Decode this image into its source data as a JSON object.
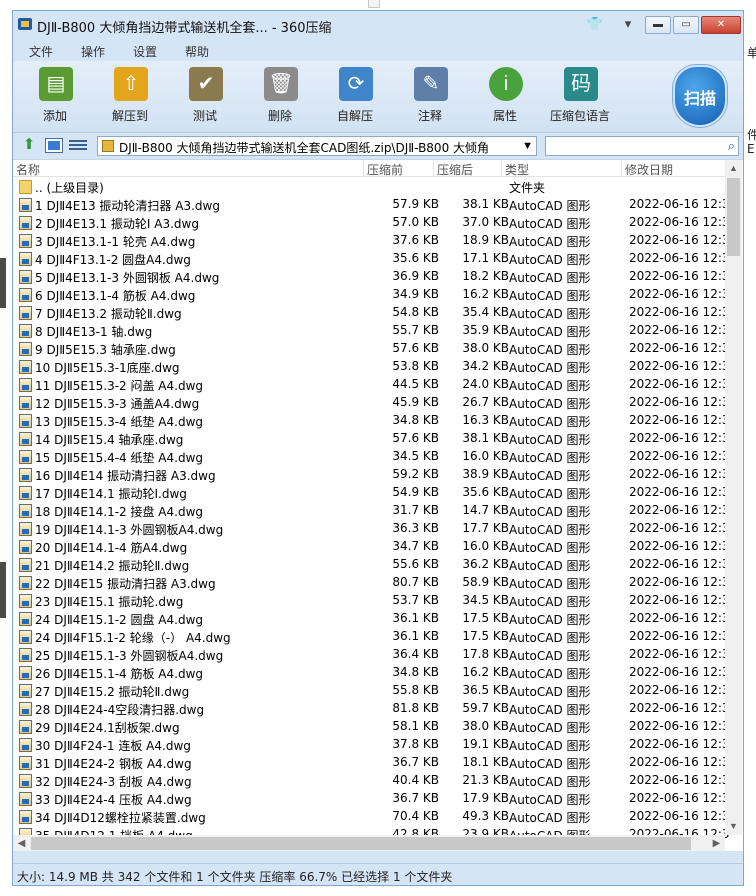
{
  "window": {
    "title": "DJⅡ-B800 大倾角挡边带式输送机全套... - 360压缩"
  },
  "menu": [
    "文件",
    "操作",
    "设置",
    "帮助"
  ],
  "toolbar": {
    "buttons": [
      {
        "label": "添加",
        "icon": "add-archive-icon",
        "color": "#5a9b34"
      },
      {
        "label": "解压到",
        "icon": "extract-to-icon",
        "color": "#e2a51b"
      },
      {
        "label": "测试",
        "icon": "test-icon",
        "color": "#8a7a4e"
      },
      {
        "label": "删除",
        "icon": "delete-icon",
        "color": "#8b8b8b"
      },
      {
        "label": "自解压",
        "icon": "self-extract-icon",
        "color": "#3e86c9"
      },
      {
        "label": "注释",
        "icon": "comment-icon",
        "color": "#5d7fa8"
      },
      {
        "label": "属性",
        "icon": "info-icon",
        "color": "#4aa23c"
      },
      {
        "label": "压缩包语言",
        "icon": "language-icon",
        "color": "#2a8a8a"
      }
    ],
    "scan_label": "扫描"
  },
  "address": {
    "path": "DJⅡ-B800 大倾角挡边带式输送机全套CAD图纸.zip\\DJⅡ-B800 大倾角",
    "search_placeholder": ""
  },
  "columns": {
    "name": "名称",
    "original_size": "压缩前",
    "compressed_size": "压缩后",
    "type": "类型",
    "modified": "修改日期"
  },
  "files": [
    {
      "name": ".. (上级目录)",
      "osz": "",
      "csz": "",
      "type": "文件夹",
      "date": "",
      "folder": true
    },
    {
      "name": "1 DJⅡ4E13 振动轮清扫器 A3.dwg",
      "osz": "57.9 KB",
      "csz": "38.1 KB",
      "type": "AutoCAD 图形",
      "date": "2022-06-16 12:3"
    },
    {
      "name": "2 DJⅡ4E13.1 振动轮Ⅰ A3.dwg",
      "osz": "57.0 KB",
      "csz": "37.0 KB",
      "type": "AutoCAD 图形",
      "date": "2022-06-16 12:3"
    },
    {
      "name": "3 DJⅡ4E13.1-1 轮壳 A4.dwg",
      "osz": "37.6 KB",
      "csz": "18.9 KB",
      "type": "AutoCAD 图形",
      "date": "2022-06-16 12:3"
    },
    {
      "name": "4 DJⅡ4F13.1-2 圆盘A4.dwg",
      "osz": "35.6 KB",
      "csz": "17.1 KB",
      "type": "AutoCAD 图形",
      "date": "2022-06-16 12:3"
    },
    {
      "name": "5 DJⅡ4E13.1-3 外圆钢板 A4.dwg",
      "osz": "36.9 KB",
      "csz": "18.2 KB",
      "type": "AutoCAD 图形",
      "date": "2022-06-16 12:3"
    },
    {
      "name": "6 DJⅡ4E13.1-4 筋板 A4.dwg",
      "osz": "34.9 KB",
      "csz": "16.2 KB",
      "type": "AutoCAD 图形",
      "date": "2022-06-16 12:3"
    },
    {
      "name": "7 DJⅡ4E13.2 振动轮Ⅱ.dwg",
      "osz": "54.8 KB",
      "csz": "35.4 KB",
      "type": "AutoCAD 图形",
      "date": "2022-06-16 12:3"
    },
    {
      "name": "8 DJⅡ4E13-1 轴.dwg",
      "osz": "55.7 KB",
      "csz": "35.9 KB",
      "type": "AutoCAD 图形",
      "date": "2022-06-16 12:3"
    },
    {
      "name": "9 DJⅡ5E15.3 轴承座.dwg",
      "osz": "57.6 KB",
      "csz": "38.0 KB",
      "type": "AutoCAD 图形",
      "date": "2022-06-16 12:3"
    },
    {
      "name": "10 DJⅡ5E15.3-1底座.dwg",
      "osz": "53.8 KB",
      "csz": "34.2 KB",
      "type": "AutoCAD 图形",
      "date": "2022-06-16 12:3"
    },
    {
      "name": "11 DJⅡ5E15.3-2 闷盖 A4.dwg",
      "osz": "44.5 KB",
      "csz": "24.0 KB",
      "type": "AutoCAD 图形",
      "date": "2022-06-16 12:3"
    },
    {
      "name": "12 DJⅡ5E15.3-3 通盖A4.dwg",
      "osz": "45.9 KB",
      "csz": "26.7 KB",
      "type": "AutoCAD 图形",
      "date": "2022-06-16 12:3"
    },
    {
      "name": "13 DJⅡ5E15.3-4 纸垫 A4.dwg",
      "osz": "34.8 KB",
      "csz": "16.3 KB",
      "type": "AutoCAD 图形",
      "date": "2022-06-16 12:3"
    },
    {
      "name": "14 DJⅡ5E15.4 轴承座.dwg",
      "osz": "57.6 KB",
      "csz": "38.1 KB",
      "type": "AutoCAD 图形",
      "date": "2022-06-16 12:3"
    },
    {
      "name": "15 DJⅡ5E15.4-4 纸垫 A4.dwg",
      "osz": "34.5 KB",
      "csz": "16.0 KB",
      "type": "AutoCAD 图形",
      "date": "2022-06-16 12:3"
    },
    {
      "name": "16 DJⅡ4E14 振动清扫器 A3.dwg",
      "osz": "59.2 KB",
      "csz": "38.9 KB",
      "type": "AutoCAD 图形",
      "date": "2022-06-16 12:3"
    },
    {
      "name": "17 DJⅡ4E14.1 振动轮Ⅰ.dwg",
      "osz": "54.9 KB",
      "csz": "35.6 KB",
      "type": "AutoCAD 图形",
      "date": "2022-06-16 12:3"
    },
    {
      "name": "18 DJⅡ4E14.1-2 接盘 A4.dwg",
      "osz": "31.7 KB",
      "csz": "14.7 KB",
      "type": "AutoCAD 图形",
      "date": "2022-06-16 12:3"
    },
    {
      "name": "19 DJⅡ4E14.1-3 外圆钢板A4.dwg",
      "osz": "36.3 KB",
      "csz": "17.7 KB",
      "type": "AutoCAD 图形",
      "date": "2022-06-16 12:3"
    },
    {
      "name": "20 DJⅡ4E14.1-4 筋A4.dwg",
      "osz": "34.7 KB",
      "csz": "16.0 KB",
      "type": "AutoCAD 图形",
      "date": "2022-06-16 12:3"
    },
    {
      "name": "21 DJⅡ4E14.2 振动轮Ⅱ.dwg",
      "osz": "55.6 KB",
      "csz": "36.2 KB",
      "type": "AutoCAD 图形",
      "date": "2022-06-16 12:3"
    },
    {
      "name": "22 DJⅡ4E15 振动清扫器 A3.dwg",
      "osz": "80.7 KB",
      "csz": "58.9 KB",
      "type": "AutoCAD 图形",
      "date": "2022-06-16 12:3"
    },
    {
      "name": "23 DJⅡ4E15.1 振动轮.dwg",
      "osz": "53.7 KB",
      "csz": "34.5 KB",
      "type": "AutoCAD 图形",
      "date": "2022-06-16 12:3"
    },
    {
      "name": "24 DJⅡ4E15.1-2 圆盘 A4.dwg",
      "osz": "36.1 KB",
      "csz": "17.5 KB",
      "type": "AutoCAD 图形",
      "date": "2022-06-16 12:3"
    },
    {
      "name": "24 DJⅡ4F15.1-2 轮缘（-） A4.dwg",
      "osz": "36.1 KB",
      "csz": "17.5 KB",
      "type": "AutoCAD 图形",
      "date": "2022-06-16 12:3"
    },
    {
      "name": "25 DJⅡ4E15.1-3 外圆钢板A4.dwg",
      "osz": "36.4 KB",
      "csz": "17.8 KB",
      "type": "AutoCAD 图形",
      "date": "2022-06-16 12:3"
    },
    {
      "name": "26 DJⅡ4E15.1-4 筋板 A4.dwg",
      "osz": "34.8 KB",
      "csz": "16.2 KB",
      "type": "AutoCAD 图形",
      "date": "2022-06-16 12:3"
    },
    {
      "name": "27 DJⅡ4E15.2 振动轮Ⅱ.dwg",
      "osz": "55.8 KB",
      "csz": "36.5 KB",
      "type": "AutoCAD 图形",
      "date": "2022-06-16 12:3"
    },
    {
      "name": "28 DJⅡ4E24-4空段清扫器.dwg",
      "osz": "81.8 KB",
      "csz": "59.7 KB",
      "type": "AutoCAD 图形",
      "date": "2022-06-16 12:3"
    },
    {
      "name": "29 DJⅡ4E24.1刮板架.dwg",
      "osz": "58.1 KB",
      "csz": "38.0 KB",
      "type": "AutoCAD 图形",
      "date": "2022-06-16 12:3"
    },
    {
      "name": "30 DJⅡ4F24-1 连板 A4.dwg",
      "osz": "37.8 KB",
      "csz": "19.1 KB",
      "type": "AutoCAD 图形",
      "date": "2022-06-16 12:3"
    },
    {
      "name": "31 DJⅡ4E24-2 钢板 A4.dwg",
      "osz": "36.7 KB",
      "csz": "18.1 KB",
      "type": "AutoCAD 图形",
      "date": "2022-06-16 12:3"
    },
    {
      "name": "32 DJⅡ4E24-3 刮板 A4.dwg",
      "osz": "40.4 KB",
      "csz": "21.3 KB",
      "type": "AutoCAD 图形",
      "date": "2022-06-16 12:3"
    },
    {
      "name": "33 DJⅡ4E24-4 压板 A4.dwg",
      "osz": "36.7 KB",
      "csz": "17.9 KB",
      "type": "AutoCAD 图形",
      "date": "2022-06-16 12:3"
    },
    {
      "name": "34 DJⅡ4D12螺栓拉紧装置.dwg",
      "osz": "70.4 KB",
      "csz": "49.3 KB",
      "type": "AutoCAD 图形",
      "date": "2022-06-16 12:3"
    },
    {
      "name": "35 DJⅡ4D12.1 挡板 A4.dwg",
      "osz": "42.8 KB",
      "csz": "23.9 KB",
      "type": "AutoCAD 图形",
      "date": "2022-06-16 12:3"
    }
  ],
  "status": "大小: 14.9 MB 共 342 个文件和 1 个文件夹 压缩率 66.7% 已经选择 1 个文件夹",
  "background_right": [
    "单",
    "件",
    "E"
  ]
}
